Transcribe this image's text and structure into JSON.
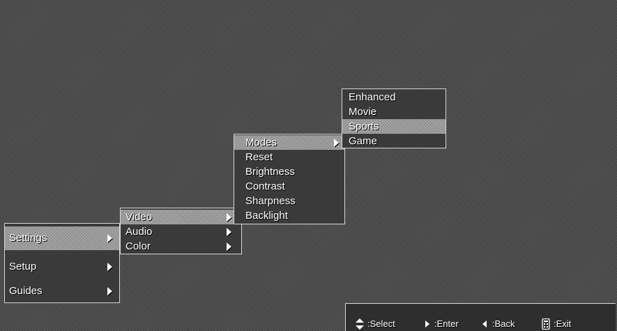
{
  "menu_level1": {
    "items": [
      {
        "label": "Settings"
      },
      {
        "label": "Setup"
      },
      {
        "label": "Guides"
      }
    ]
  },
  "menu_level2": {
    "items": [
      {
        "label": "Video"
      },
      {
        "label": "Audio"
      },
      {
        "label": "Color"
      }
    ]
  },
  "menu_level3": {
    "items": [
      {
        "label": "Modes"
      },
      {
        "label": "Reset"
      },
      {
        "label": "Brightness"
      },
      {
        "label": "Contrast"
      },
      {
        "label": "Sharpness"
      },
      {
        "label": "Backlight"
      }
    ]
  },
  "menu_level4": {
    "items": [
      {
        "label": "Enhanced"
      },
      {
        "label": "Movie"
      },
      {
        "label": "Sports"
      },
      {
        "label": "Game"
      }
    ]
  },
  "helpbar": {
    "select": ":Select",
    "enter": ":Enter",
    "back": ":Back",
    "exit": ":Exit"
  },
  "icons": {
    "submenu": "chevron-right-icon",
    "select": "up-down-arrow-icon",
    "enter": "right-arrow-icon",
    "back": "left-arrow-icon",
    "exit": "remote-icon"
  },
  "colors": {
    "background": "#4a4a4a",
    "menu_background": "#3a3a3a",
    "highlight": "#9a9a9a",
    "border": "#d8d8d8",
    "text": "#ffffff"
  }
}
